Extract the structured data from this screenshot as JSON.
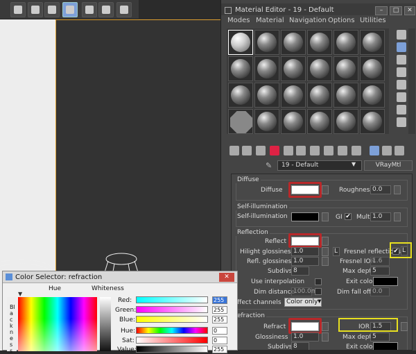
{
  "material_editor": {
    "title": "Material Editor - 19 - Default",
    "window_buttons": [
      "–",
      "□",
      "✕"
    ],
    "menu": [
      "Modes",
      "Material",
      "Navigation",
      "Options",
      "Utilities"
    ],
    "material_name": "19 - Default",
    "material_type": "VRayMtl"
  },
  "params": {
    "diffuse": {
      "group": "Diffuse",
      "label": "Diffuse",
      "roughness_label": "Roughness",
      "roughness": "0.0"
    },
    "self_illum": {
      "group": "Self-illumination",
      "label": "Self-illumination",
      "gi_label": "GI",
      "gi_check": "✔",
      "mult_label": "Mult",
      "mult": "1.0"
    },
    "reflection": {
      "group": "Reflection",
      "reflect_label": "Reflect",
      "hilight_label": "Hilight glossiness",
      "hilight": "1.0",
      "l_button": "L",
      "fresnel_label": "Fresnel reflections",
      "fresnel_check": "✔",
      "refl_gloss_label": "Refl. glossiness",
      "refl_gloss": "1.0",
      "fresnel_ior_label": "Fresnel IOR",
      "fresnel_ior": "1.6",
      "subdivs_label": "Subdivs",
      "subdivs": "8",
      "max_depth_label": "Max depth",
      "max_depth": "5",
      "interp_label": "Use interpolation",
      "exit_color_label": "Exit color",
      "dim_dist_label": "Dim distance",
      "dim_dist": "100.0m",
      "dim_falloff_label": "Dim fall off",
      "dim_falloff": "0.0",
      "affect_label": "Affect channels",
      "affect_value": "Color only"
    },
    "refraction": {
      "group": "Refraction",
      "refract_label": "Refract",
      "ior_label": "IOR",
      "ior": "1.5",
      "gloss_label": "Glossiness",
      "gloss": "1.0",
      "max_depth_label": "Max depth",
      "max_depth": "5",
      "subdivs_label": "Subdivs",
      "subdivs": "8",
      "exit_color_label": "Exit color"
    }
  },
  "color_selector": {
    "title": "Color Selector: refraction",
    "close": "✕",
    "hue_label": "Hue",
    "whiteness_label": "Whiteness",
    "blackness_label": "Blackness",
    "red_label": "Red:",
    "red": "255",
    "green_label": "Green:",
    "green": "255",
    "blue_label": "Blue:",
    "blue": "255",
    "hue_field_label": "Hue:",
    "hue": "0",
    "sat_label": "Sat:",
    "sat": "0",
    "value_label": "Value:",
    "value": "255"
  }
}
